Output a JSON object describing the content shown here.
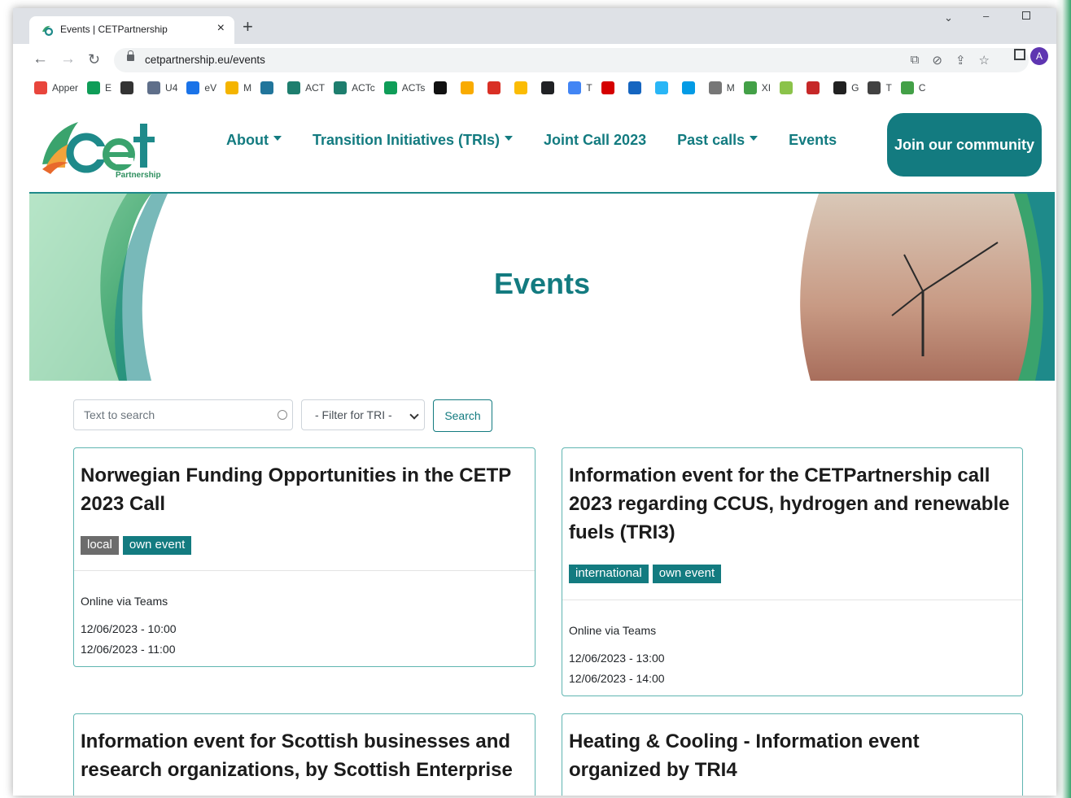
{
  "browser": {
    "tab_title": "Events | CETPartnership",
    "url": "cetpartnership.eu/events",
    "avatar_letter": "A",
    "bookmarks": [
      {
        "label": "Apper",
        "color": "#e8453c",
        "icon": "apps-grid-icon"
      },
      {
        "label": "E",
        "color": "#0f9d58",
        "icon": "dollar-icon"
      },
      {
        "label": "",
        "color": "#333333",
        "icon": "bird-icon"
      },
      {
        "label": "U4",
        "color": "#5f6f8a",
        "icon": "u4-icon"
      },
      {
        "label": "eV",
        "color": "#1a73e8",
        "icon": "ev-icon"
      },
      {
        "label": "M",
        "color": "#f4b400",
        "icon": "pinwheel-icon"
      },
      {
        "label": "",
        "color": "#21759b",
        "icon": "wordpress-icon"
      },
      {
        "label": "ACT",
        "color": "#1e7e6e",
        "icon": "c-icon"
      },
      {
        "label": "ACTc",
        "color": "#1e7e6e",
        "icon": "c-icon"
      },
      {
        "label": "ACTs",
        "color": "#0f9d58",
        "icon": "dollar-icon"
      },
      {
        "label": "",
        "color": "#111111",
        "icon": "wikipedia-icon"
      },
      {
        "label": "",
        "color": "#f9ab00",
        "icon": "gs-icon"
      },
      {
        "label": "",
        "color": "#d93025",
        "icon": "gmail-icon"
      },
      {
        "label": "",
        "color": "#fbbc04",
        "icon": "maps-icon"
      },
      {
        "label": "",
        "color": "#202124",
        "icon": "openai-icon"
      },
      {
        "label": "T",
        "color": "#4285f4",
        "icon": "translate-icon"
      },
      {
        "label": "",
        "color": "#d50000",
        "icon": "red-icon"
      },
      {
        "label": "",
        "color": "#1565c0",
        "icon": "blue-icon"
      },
      {
        "label": "",
        "color": "#29b6f6",
        "icon": "circle-icon"
      },
      {
        "label": "",
        "color": "#039be5",
        "icon": "vr-icon"
      },
      {
        "label": "M",
        "color": "#777777",
        "icon": "crest-icon"
      },
      {
        "label": "XI",
        "color": "#43a047",
        "icon": "w-icon"
      },
      {
        "label": "",
        "color": "#8bc34a",
        "icon": "frame-icon"
      },
      {
        "label": "",
        "color": "#c62828",
        "icon": "shield-icon"
      },
      {
        "label": "G",
        "color": "#212121",
        "icon": "b-icon"
      },
      {
        "label": "T",
        "color": "#424242",
        "icon": "globe-icon"
      },
      {
        "label": "C",
        "color": "#43a047",
        "icon": "cet-icon"
      }
    ]
  },
  "site": {
    "logo_text": "cet",
    "logo_sub": "Partnership",
    "nav": {
      "about": "About",
      "tri": "Transition Initiatives (TRIs)",
      "joint_call": "Joint Call 2023",
      "past_calls": "Past calls",
      "events": "Events"
    },
    "join_button": "Join our community",
    "hero_title": "Events",
    "search": {
      "placeholder": "Text to search",
      "filter_label": "- Filter for TRI -",
      "button": "Search"
    },
    "cards": [
      {
        "title": "Norwegian Funding Opportunities in the CETP 2023 Call",
        "badges": [
          "local",
          "own event"
        ],
        "location": "Online via Teams",
        "start": "12/06/2023 - 10:00",
        "end": "12/06/2023 - 11:00"
      },
      {
        "title": "Information event for the CETPartnership call 2023 regarding CCUS, hydrogen and renewable fuels (TRI3)",
        "badges": [
          "international",
          "own event"
        ],
        "location": "Online via Teams",
        "start": "12/06/2023 - 13:00",
        "end": "12/06/2023 - 14:00"
      },
      {
        "title": "Information event for Scottish businesses and research organizations, by Scottish Enterprise"
      },
      {
        "title": "Heating & Cooling - Information event organized by TRI4"
      }
    ]
  }
}
